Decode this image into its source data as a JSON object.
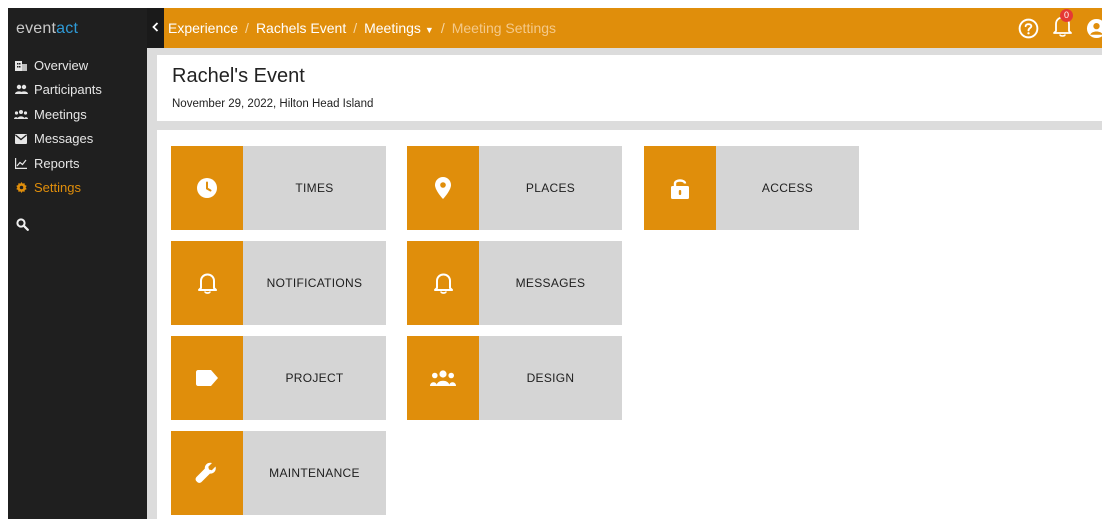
{
  "sidebar": {
    "logo_prefix": "event",
    "logo_accent": "act",
    "items": [
      {
        "label": "Overview",
        "icon": "building-icon"
      },
      {
        "label": "Participants",
        "icon": "users-icon"
      },
      {
        "label": "Meetings",
        "icon": "group-icon"
      },
      {
        "label": "Messages",
        "icon": "envelope-icon"
      },
      {
        "label": "Reports",
        "icon": "chart-icon"
      },
      {
        "label": "Settings",
        "icon": "gear-icon",
        "active": true
      }
    ],
    "search_icon": "search-icon"
  },
  "topbar": {
    "breadcrumb": [
      {
        "label": "Experience"
      },
      {
        "label": "Rachels Event"
      },
      {
        "label": "Meetings"
      },
      {
        "label": "Meeting Settings"
      }
    ],
    "notification_count": "0",
    "icons": [
      "help-icon",
      "bell-icon",
      "user-icon"
    ]
  },
  "event": {
    "title": "Rachel's Event",
    "subtitle": "November 29, 2022, Hilton Head Island"
  },
  "tiles": [
    {
      "label": "TIMES",
      "icon": "clock-icon"
    },
    {
      "label": "PLACES",
      "icon": "map-pin-icon"
    },
    {
      "label": "ACCESS",
      "icon": "lock-icon"
    },
    {
      "label": "NOTIFICATIONS",
      "icon": "bell-icon"
    },
    {
      "label": "MESSAGES",
      "icon": "bell-icon"
    },
    {
      "label": "PROJECT",
      "icon": "tag-icon"
    },
    {
      "label": "DESIGN",
      "icon": "users-group-icon"
    },
    {
      "label": "MAINTENANCE",
      "icon": "wrench-icon"
    }
  ],
  "colors": {
    "accent": "#e08e0b",
    "sidebar_bg": "#1f1f1f",
    "tile_label_bg": "#d5d5d5",
    "logo_accent": "#2f9ad6",
    "badge": "#e53935"
  }
}
